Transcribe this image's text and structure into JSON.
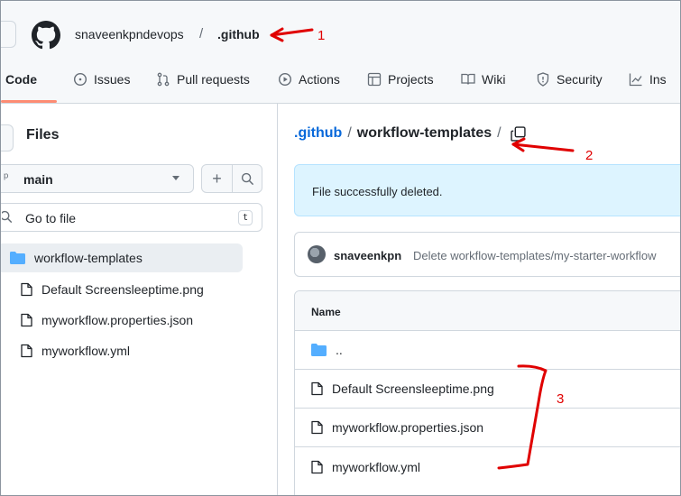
{
  "header": {
    "owner": "snaveenkpndevops",
    "separator": "/",
    "repo": ".github"
  },
  "nav": {
    "tabs": [
      {
        "label": "Code",
        "icon": "code-icon"
      },
      {
        "label": "Issues",
        "icon": "issue-icon"
      },
      {
        "label": "Pull requests",
        "icon": "pull-request-icon"
      },
      {
        "label": "Actions",
        "icon": "play-icon"
      },
      {
        "label": "Projects",
        "icon": "table-icon"
      },
      {
        "label": "Wiki",
        "icon": "book-icon"
      },
      {
        "label": "Security",
        "icon": "shield-icon"
      },
      {
        "label": "Ins",
        "icon": "graph-icon"
      }
    ]
  },
  "sidebar": {
    "title": "Files",
    "branch": "main",
    "search_placeholder": "Go to file",
    "shortcut_key": "t",
    "tree": [
      {
        "label": "workflow-templates",
        "type": "folder"
      },
      {
        "label": "Default Screensleeptime.png",
        "type": "file"
      },
      {
        "label": "myworkflow.properties.json",
        "type": "file"
      },
      {
        "label": "myworkflow.yml",
        "type": "file"
      }
    ]
  },
  "main": {
    "breadcrumb": {
      "root": ".github",
      "dir": "workflow-templates",
      "sep": "/"
    },
    "flash": "File successfully deleted.",
    "commit": {
      "author": "snaveenkpn",
      "message": "Delete workflow-templates/my-starter-workflow"
    },
    "table": {
      "header": "Name",
      "rows": [
        {
          "label": "..",
          "type": "folder"
        },
        {
          "label": "Default Screensleeptime.png",
          "type": "file"
        },
        {
          "label": "myworkflow.properties.json",
          "type": "file"
        },
        {
          "label": "myworkflow.yml",
          "type": "file"
        }
      ]
    }
  },
  "annotations": [
    "1",
    "2",
    "3"
  ],
  "colors": {
    "link": "#0969da",
    "annotation": "#e00000",
    "folder": "#54aeff",
    "flash_bg": "#ddf4ff",
    "tab_underline": "#fd8c73"
  }
}
